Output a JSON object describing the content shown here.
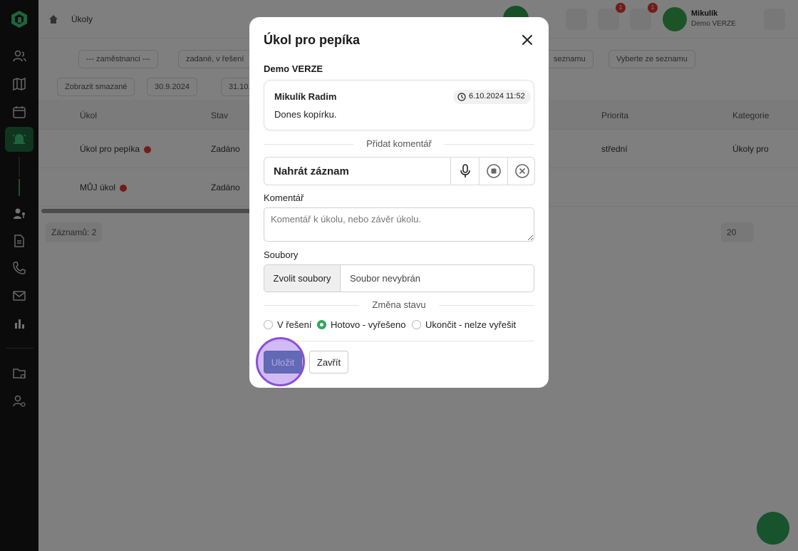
{
  "background": {
    "breadcrumb": "Úkoly",
    "user": {
      "name": "Mikulík",
      "sub": "Demo VERZE"
    },
    "badges": [
      "1",
      "1"
    ],
    "filters": [
      "--- zaměstnanci ---",
      "zadané, v řešení",
      "seznamu",
      "Vyberte ze seznamu"
    ],
    "filter_row2": [
      "Zobrazit smazané",
      "30.9.2024",
      "31.10."
    ],
    "table": {
      "headers": [
        "Úkol",
        "Stav",
        "Priorita",
        "Kategorie"
      ],
      "rows": [
        {
          "task": "Úkol pro pepíka",
          "state": "Zadáno",
          "priority": "střední",
          "category": "Úkoly pro"
        },
        {
          "task": "MŮJ úkol",
          "state": "Zadáno",
          "priority": "",
          "category": ""
        }
      ]
    },
    "records": "Záznamů: 2",
    "per_page": "20"
  },
  "modal": {
    "title": "Úkol pro pepíka",
    "subtitle": "Demo VERZE",
    "comment": {
      "author": "Mikulík Radim",
      "time": "6.10.2024 11:52",
      "text": "Dones kopírku."
    },
    "add_comment_label": "Přidat komentář",
    "recorder_label": "Nahrát záznam",
    "comment_field_label": "Komentář",
    "comment_placeholder": "Komentář k úkolu, nebo závěr úkolu.",
    "files_label": "Soubory",
    "files_button": "Zvolit soubory",
    "files_none": "Soubor nevybrán",
    "state_change_label": "Změna stavu",
    "states": [
      {
        "label": "V řešení",
        "selected": false
      },
      {
        "label": "Hotovo - vyřešeno",
        "selected": true
      },
      {
        "label": "Ukončit - nelze vyřešit",
        "selected": false
      }
    ],
    "save_label": "Uložit",
    "close_label": "Zavřít"
  },
  "colors": {
    "accent_green": "#2ea95a",
    "save_blue": "#346c91",
    "click_ring": "#8a4fd8"
  }
}
